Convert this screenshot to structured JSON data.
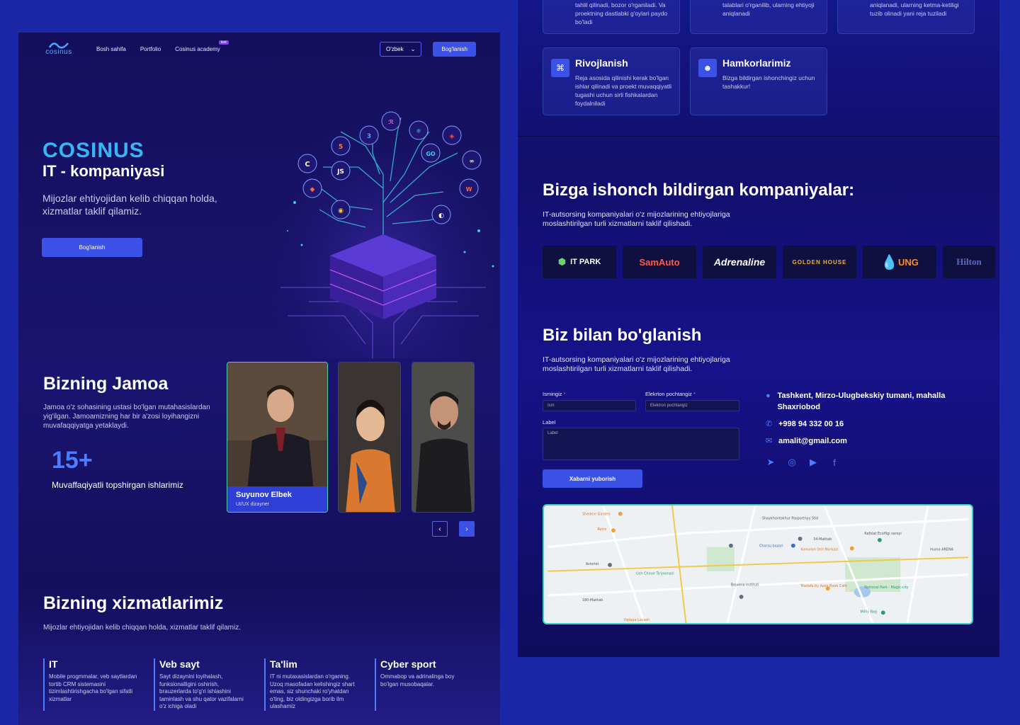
{
  "nav": {
    "logo": "cosinus",
    "links": [
      "Bosh sahifa",
      "Portfolio",
      "Cosinus academy"
    ],
    "academy_badge": "test",
    "language": "O'zbek",
    "cta": "Bog'lanish"
  },
  "hero": {
    "brand": "COSINUS",
    "title": "IT - kompaniyasi",
    "subtitle": "Mijozlar ehtiyojidan kelib chiqqan holda, xizmatlar taklif qilamiz.",
    "button": "Bog'lanish",
    "tech_icons": [
      "JS",
      "GO"
    ]
  },
  "team": {
    "title": "Bizning Jamoa",
    "description": "Jamoa o'z sohasining ustasi bo'lgan mutahasislardan yig'ilgan. Jamoamizning har bir a'zosi loyihangizni muvafaqqiyatga yetaklaydi.",
    "stat_number": "15+",
    "stat_label": "Muvaffaqiyatli topshirgan ishlarimiz",
    "member": {
      "name": "Suyunov Elbek",
      "role": "UI/UX dizayner"
    }
  },
  "services": {
    "title": "Bizning xizmatlarimiz",
    "description": "Mijozlar ehtiyojidan kelib chiqqan holda, xizmatlar taklif qilamiz.",
    "items": [
      {
        "title": "IT",
        "text": "Mobile progmmalar, veb saytlardan tortib CRM sistemasini tizimlashtirishgacha bo'lgan sifatli xizmatlar"
      },
      {
        "title": "Veb sayt",
        "text": "Sayt dizaynini loyihalash, funksionalligini oshirish, brauzerlarda to'g'ri ishlashini taminlash va shu qator vazifalarni o'z ichiga oladi"
      },
      {
        "title": "Ta'lim",
        "text": "IT ni mutaxasislardan o'rganing. Uzoq masofadan kelishingiz shart emas, siz shunchaki ro'yhatdan o'ting, biz oldingizga borib ilm ulashamiz"
      },
      {
        "title": "Cyber sport",
        "text": "Ommabop va adrinalinga boy bo'lgan musobaqalar."
      }
    ]
  },
  "steps": {
    "top_texts": [
      "tahlil qilinadi, bozor o'rganiladi. Va proektning dastlabki g'oylari paydo bo'ladi",
      "talablari o'rganilib, ularning ehtiyoji aniqlanadi",
      "aniqlanadi, ularning ketma-ketiligi tuzib olinadi yani reja tuziladi"
    ],
    "cards": [
      {
        "title": "Rivojlanish",
        "text": "Reja asosida qilinishi kerak bo'lgan ishlar qilinadi va proekt muvaqqiyatli tugashi uchun sirli fishkalardan foydalniladi"
      },
      {
        "title": "Hamkorlarimiz",
        "text": "Bizga bildirgan ishonchingiz uchun tashakkur!"
      }
    ]
  },
  "trust": {
    "title": "Bizga ishonch bildirgan kompaniyalar:",
    "description": "IT-autsorsing kompaniyalari o'z mijozlarining ehtiyojlariga moslashtirilgan turli xizmatlarni taklif qilishadi.",
    "logos": [
      "IT PARK",
      "SamAuto",
      "Adrenaline",
      "GOLDEN HOUSE",
      "UNG",
      "Hilton"
    ]
  },
  "contact": {
    "title": "Biz bilan bo'glanish",
    "description": "IT-autsorsing kompaniyalari o'z mijozlarining ehtiyojlariga moslashtirilgan turli xizmatlarni taklif qilishadi.",
    "name_label": "Ismingiz",
    "name_placeholder": "Ism",
    "email_label": "Elekrton pochtangiz",
    "email_placeholder": "Elektron pochtangiz",
    "message_label": "Label",
    "message_placeholder": "Label",
    "submit": "Xabarni yuborish",
    "address": "Tashkent, Mirzo-Ulugbekskiy tumani, mahalla Shaxriobod",
    "phone": "+998 94 332 00 16",
    "email": "amalit@gmail.com"
  },
  "map": {
    "labels": [
      "Shedevr Garden",
      "Retro",
      "Shaykhontokhur Pasportnyy Stol",
      "34-Maktab",
      "Kafolat Ecofilgi saroyi",
      "Chorsu bozori",
      "Humo ARENA",
      "Kamolon Osh Markazi",
      "Uch Chinor To'yxonasi",
      "Bojxona Instituti",
      "Madafa by Azon Book Cafe",
      "National Park - Magic-city",
      "Milliy Bog",
      "180-Maktab",
      "Aviorlet",
      "Oqtepa Lavash"
    ]
  },
  "colors": {
    "accent": "#3c52e6",
    "brand": "#38b6f3",
    "bg": "#1c27a8"
  }
}
